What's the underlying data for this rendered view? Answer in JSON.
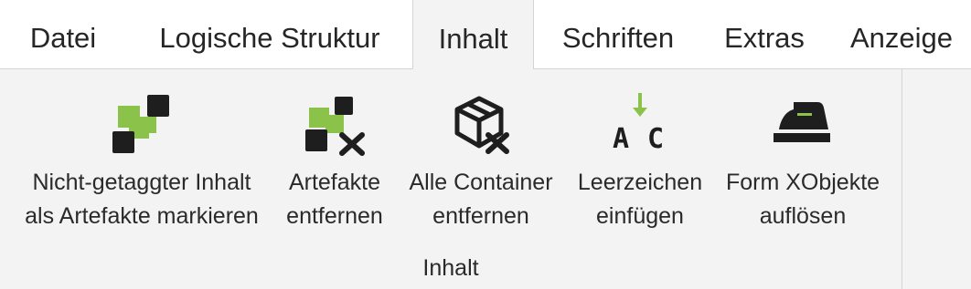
{
  "tabs": [
    {
      "label": "Datei"
    },
    {
      "label": "Logische Struktur"
    },
    {
      "label": "Inhalt"
    },
    {
      "label": "Schriften"
    },
    {
      "label": "Extras"
    },
    {
      "label": "Anzeige"
    }
  ],
  "ribbon": {
    "group_label": "Inhalt",
    "buttons": [
      {
        "line1": "Nicht-getaggter Inhalt",
        "line2": "als Artefakte markieren",
        "icon": "artifact-mark-icon"
      },
      {
        "line1": "Artefakte",
        "line2": "entfernen",
        "icon": "artifact-remove-icon"
      },
      {
        "line1": "Alle Container",
        "line2": "entfernen",
        "icon": "container-remove-icon"
      },
      {
        "line1": "Leerzeichen",
        "line2": "einfügen",
        "icon": "insert-space-icon"
      },
      {
        "line1": "Form XObjekte",
        "line2": "auflösen",
        "icon": "flatten-iron-icon"
      }
    ]
  },
  "colors": {
    "accent_green": "#8bc34a",
    "icon_dark": "#1e1e1e",
    "active_tab_bg": "#f3f3f3"
  }
}
